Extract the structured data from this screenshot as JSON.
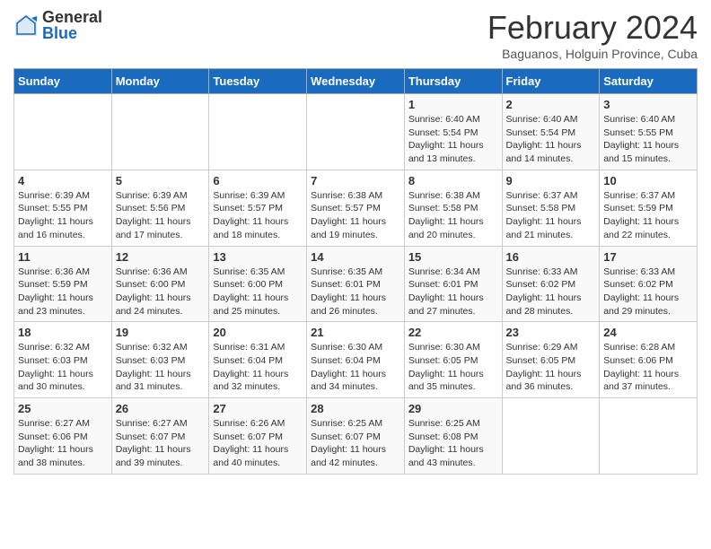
{
  "logo": {
    "general": "General",
    "blue": "Blue"
  },
  "title": "February 2024",
  "subtitle": "Baguanos, Holguin Province, Cuba",
  "days_header": [
    "Sunday",
    "Monday",
    "Tuesday",
    "Wednesday",
    "Thursday",
    "Friday",
    "Saturday"
  ],
  "weeks": [
    [
      {
        "day": "",
        "info": ""
      },
      {
        "day": "",
        "info": ""
      },
      {
        "day": "",
        "info": ""
      },
      {
        "day": "",
        "info": ""
      },
      {
        "day": "1",
        "info": "Sunrise: 6:40 AM\nSunset: 5:54 PM\nDaylight: 11 hours and 13 minutes."
      },
      {
        "day": "2",
        "info": "Sunrise: 6:40 AM\nSunset: 5:54 PM\nDaylight: 11 hours and 14 minutes."
      },
      {
        "day": "3",
        "info": "Sunrise: 6:40 AM\nSunset: 5:55 PM\nDaylight: 11 hours and 15 minutes."
      }
    ],
    [
      {
        "day": "4",
        "info": "Sunrise: 6:39 AM\nSunset: 5:55 PM\nDaylight: 11 hours and 16 minutes."
      },
      {
        "day": "5",
        "info": "Sunrise: 6:39 AM\nSunset: 5:56 PM\nDaylight: 11 hours and 17 minutes."
      },
      {
        "day": "6",
        "info": "Sunrise: 6:39 AM\nSunset: 5:57 PM\nDaylight: 11 hours and 18 minutes."
      },
      {
        "day": "7",
        "info": "Sunrise: 6:38 AM\nSunset: 5:57 PM\nDaylight: 11 hours and 19 minutes."
      },
      {
        "day": "8",
        "info": "Sunrise: 6:38 AM\nSunset: 5:58 PM\nDaylight: 11 hours and 20 minutes."
      },
      {
        "day": "9",
        "info": "Sunrise: 6:37 AM\nSunset: 5:58 PM\nDaylight: 11 hours and 21 minutes."
      },
      {
        "day": "10",
        "info": "Sunrise: 6:37 AM\nSunset: 5:59 PM\nDaylight: 11 hours and 22 minutes."
      }
    ],
    [
      {
        "day": "11",
        "info": "Sunrise: 6:36 AM\nSunset: 5:59 PM\nDaylight: 11 hours and 23 minutes."
      },
      {
        "day": "12",
        "info": "Sunrise: 6:36 AM\nSunset: 6:00 PM\nDaylight: 11 hours and 24 minutes."
      },
      {
        "day": "13",
        "info": "Sunrise: 6:35 AM\nSunset: 6:00 PM\nDaylight: 11 hours and 25 minutes."
      },
      {
        "day": "14",
        "info": "Sunrise: 6:35 AM\nSunset: 6:01 PM\nDaylight: 11 hours and 26 minutes."
      },
      {
        "day": "15",
        "info": "Sunrise: 6:34 AM\nSunset: 6:01 PM\nDaylight: 11 hours and 27 minutes."
      },
      {
        "day": "16",
        "info": "Sunrise: 6:33 AM\nSunset: 6:02 PM\nDaylight: 11 hours and 28 minutes."
      },
      {
        "day": "17",
        "info": "Sunrise: 6:33 AM\nSunset: 6:02 PM\nDaylight: 11 hours and 29 minutes."
      }
    ],
    [
      {
        "day": "18",
        "info": "Sunrise: 6:32 AM\nSunset: 6:03 PM\nDaylight: 11 hours and 30 minutes."
      },
      {
        "day": "19",
        "info": "Sunrise: 6:32 AM\nSunset: 6:03 PM\nDaylight: 11 hours and 31 minutes."
      },
      {
        "day": "20",
        "info": "Sunrise: 6:31 AM\nSunset: 6:04 PM\nDaylight: 11 hours and 32 minutes."
      },
      {
        "day": "21",
        "info": "Sunrise: 6:30 AM\nSunset: 6:04 PM\nDaylight: 11 hours and 34 minutes."
      },
      {
        "day": "22",
        "info": "Sunrise: 6:30 AM\nSunset: 6:05 PM\nDaylight: 11 hours and 35 minutes."
      },
      {
        "day": "23",
        "info": "Sunrise: 6:29 AM\nSunset: 6:05 PM\nDaylight: 11 hours and 36 minutes."
      },
      {
        "day": "24",
        "info": "Sunrise: 6:28 AM\nSunset: 6:06 PM\nDaylight: 11 hours and 37 minutes."
      }
    ],
    [
      {
        "day": "25",
        "info": "Sunrise: 6:27 AM\nSunset: 6:06 PM\nDaylight: 11 hours and 38 minutes."
      },
      {
        "day": "26",
        "info": "Sunrise: 6:27 AM\nSunset: 6:07 PM\nDaylight: 11 hours and 39 minutes."
      },
      {
        "day": "27",
        "info": "Sunrise: 6:26 AM\nSunset: 6:07 PM\nDaylight: 11 hours and 40 minutes."
      },
      {
        "day": "28",
        "info": "Sunrise: 6:25 AM\nSunset: 6:07 PM\nDaylight: 11 hours and 42 minutes."
      },
      {
        "day": "29",
        "info": "Sunrise: 6:25 AM\nSunset: 6:08 PM\nDaylight: 11 hours and 43 minutes."
      },
      {
        "day": "",
        "info": ""
      },
      {
        "day": "",
        "info": ""
      }
    ]
  ]
}
